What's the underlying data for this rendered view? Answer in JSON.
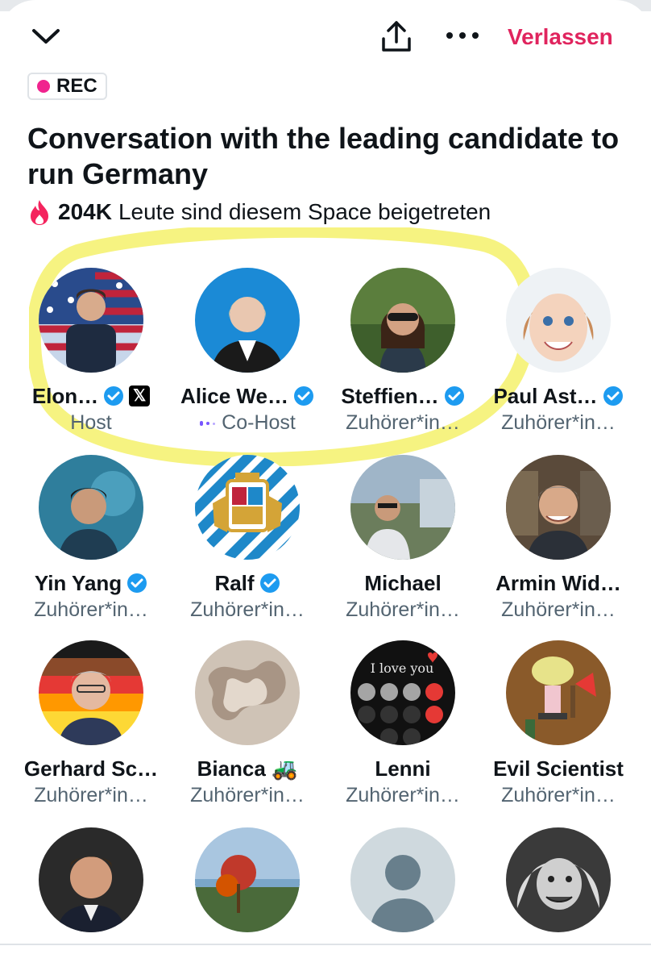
{
  "header": {
    "leave_label": "Verlassen",
    "rec_label": "REC"
  },
  "space": {
    "title": "Conversation with the leading candidate to run Germany",
    "joined_count": "204K",
    "joined_text": "Leute sind diesem Space beigetreten"
  },
  "participants": [
    {
      "name": "Elon…",
      "role": "Host",
      "verified": true,
      "x_badge": true
    },
    {
      "name": "Alice We…",
      "role": "Co-Host",
      "verified": true
    },
    {
      "name": "Steffien…",
      "role": "Zuhörer*in…",
      "verified": true
    },
    {
      "name": "Paul Ast…",
      "role": "Zuhörer*in…",
      "verified": true
    },
    {
      "name": "Yin Yang",
      "role": "Zuhörer*in…",
      "verified": true
    },
    {
      "name": "Ralf",
      "role": "Zuhörer*in…",
      "verified": true
    },
    {
      "name": "Michael",
      "role": "Zuhörer*in…",
      "verified": false
    },
    {
      "name": "Armin Wid…",
      "role": "Zuhörer*in…",
      "verified": false
    },
    {
      "name": "Gerhard Sc…",
      "role": "Zuhörer*in…",
      "verified": false
    },
    {
      "name": "Bianca 🚜",
      "role": "Zuhörer*in…",
      "verified": false
    },
    {
      "name": "Lenni",
      "role": "Zuhörer*in…",
      "verified": false
    },
    {
      "name": "Evil Scientist",
      "role": "Zuhörer*in…",
      "verified": false
    },
    {
      "name": "",
      "role": "",
      "verified": false
    },
    {
      "name": "",
      "role": "",
      "verified": false
    },
    {
      "name": "",
      "role": "",
      "verified": false
    },
    {
      "name": "",
      "role": "",
      "verified": false
    }
  ],
  "colors": {
    "accent_red": "#e0245e",
    "rec_pink": "#f0238e",
    "verified_blue": "#1d9bf0",
    "highlight_yellow": "#f6f27a",
    "muted_text": "#536471"
  },
  "icons": {
    "back": "chevron-down-icon",
    "share": "share-icon",
    "more": "more-icon",
    "fire": "fire-icon",
    "verified": "verified-badge-icon",
    "x": "x-logo-icon"
  }
}
